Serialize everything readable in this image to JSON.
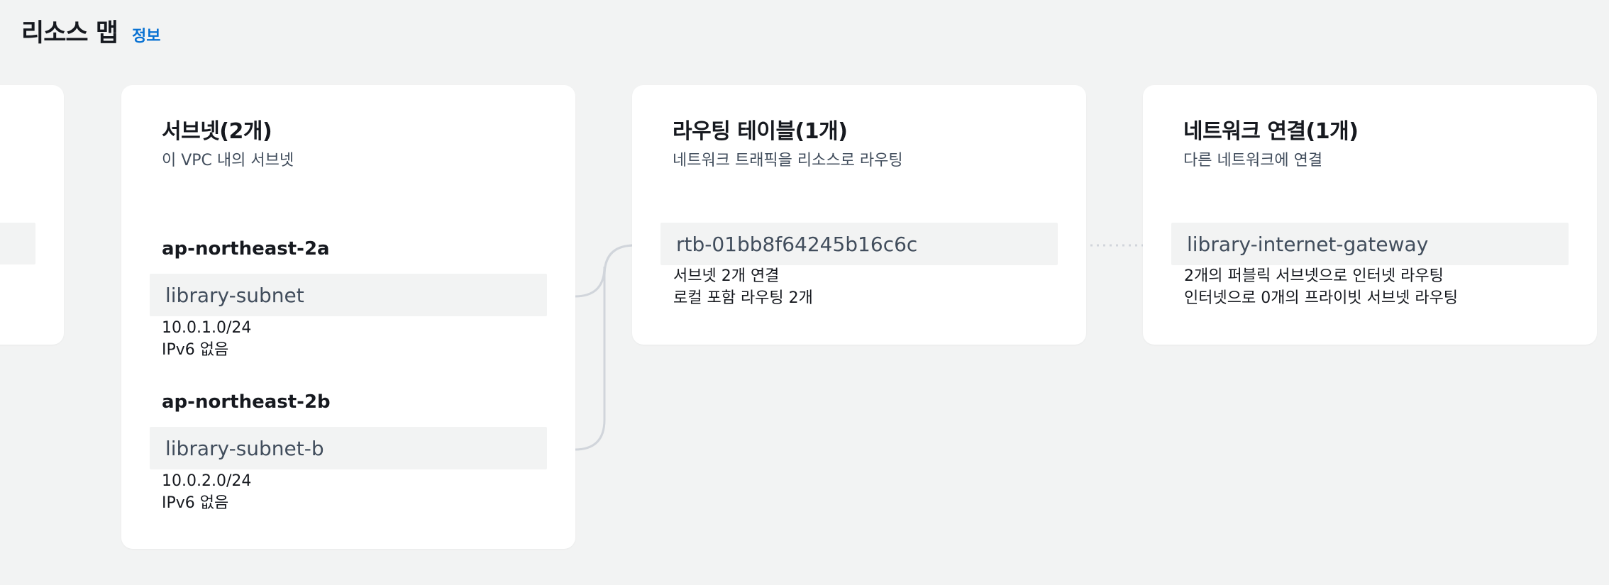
{
  "header": {
    "title": "리소스 맵",
    "info_link": "정보"
  },
  "subnets": {
    "title": "서브넷(2개)",
    "subtitle": "이 VPC 내의 서브넷",
    "zones": [
      {
        "az": "ap-northeast-2a",
        "name": "library-subnet",
        "cidr": "10.0.1.0/24",
        "ipv6": "IPv6 없음"
      },
      {
        "az": "ap-northeast-2b",
        "name": "library-subnet-b",
        "cidr": "10.0.2.0/24",
        "ipv6": "IPv6 없음"
      }
    ]
  },
  "route_tables": {
    "title": "라우팅 테이블(1개)",
    "subtitle": "네트워크 트래픽을 리소스로 라우팅",
    "items": [
      {
        "id": "rtb-01bb8f64245b16c6c",
        "line1": "서브넷 2개 연결",
        "line2": "로컬 포함 라우팅 2개"
      }
    ]
  },
  "network_connections": {
    "title": "네트워크 연결(1개)",
    "subtitle": "다른 네트워크에 연결",
    "items": [
      {
        "name": "library-internet-gateway",
        "line1": "2개의 퍼블릭 서브넷으로 인터넷 라우팅",
        "line2": "인터넷으로 0개의 프라이빗 서브넷 라우팅"
      }
    ]
  },
  "colors": {
    "background": "#f2f3f3",
    "card": "#ffffff",
    "link": "#0972d3",
    "resource_box": "#f2f3f3",
    "connector": "#d1d5db"
  }
}
